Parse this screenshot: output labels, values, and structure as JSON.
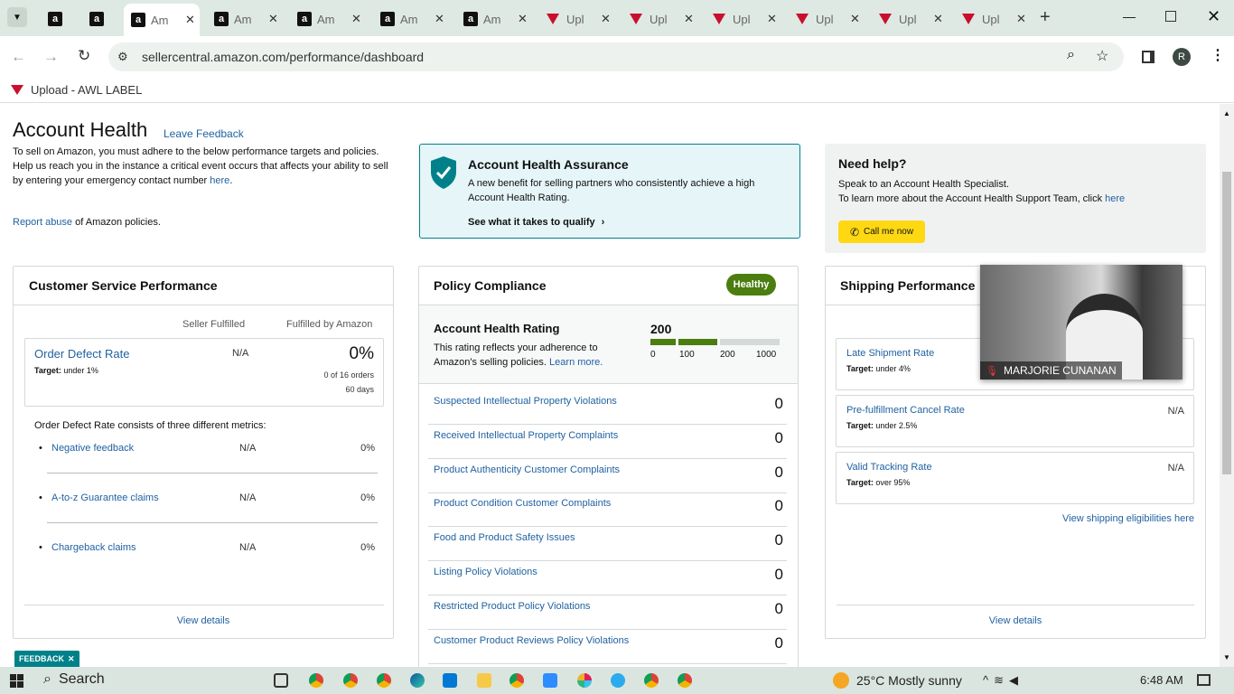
{
  "browser": {
    "tabs": [
      {
        "label": "",
        "icon": "amazon-icon"
      },
      {
        "label": "",
        "icon": "amazon-icon"
      },
      {
        "label": "Am",
        "icon": "amazon-icon",
        "active": true
      },
      {
        "label": "Am",
        "icon": "amazon-icon"
      },
      {
        "label": "Am",
        "icon": "amazon-icon"
      },
      {
        "label": "Am",
        "icon": "amazon-icon"
      },
      {
        "label": "Am",
        "icon": "amazon-icon"
      },
      {
        "label": "Upl",
        "icon": "awl-icon"
      },
      {
        "label": "Upl",
        "icon": "awl-icon"
      },
      {
        "label": "Upl",
        "icon": "awl-icon"
      },
      {
        "label": "Upl",
        "icon": "awl-icon"
      },
      {
        "label": "Upl",
        "icon": "awl-icon"
      },
      {
        "label": "Upl",
        "icon": "awl-icon"
      }
    ],
    "url": "sellercentral.amazon.com/performance/dashboard",
    "profile_initial": "R",
    "bookmark_label": "Upload - AWL LABEL"
  },
  "header": {
    "title": "Account Health",
    "feedback_link": "Leave Feedback",
    "intro_1": "To sell on Amazon, you must adhere to the below performance targets and policies.",
    "intro_2a": "Help us reach you in the instance a critical event occurs that affects your ability to sell by entering your emergency contact number ",
    "intro_2_link": "here",
    "intro_2b": ".",
    "report_link": "Report abuse",
    "report_suffix": " of Amazon policies."
  },
  "assurance": {
    "title": "Account Health Assurance",
    "text": "A new benefit for selling partners who consistently achieve a high Account Health Rating.",
    "link": "See what it takes to qualify"
  },
  "help": {
    "title": "Need help?",
    "line1": "Speak to an Account Health Specialist.",
    "line2": "To learn more about the Account Health Support Team, click ",
    "line2_link": "here",
    "button": "Call me now"
  },
  "csp": {
    "title": "Customer Service Performance",
    "col1": "Seller Fulfilled",
    "col2": "Fulfilled by Amazon",
    "odr_label": "Order Defect Rate",
    "odr_target_label": "Target:",
    "odr_target": " under 1%",
    "odr_seller": "N/A",
    "odr_fba": "0%",
    "odr_orders": "0 of 16 orders",
    "odr_days": "60 days",
    "metrics_intro": "Order Defect Rate consists of three different metrics:",
    "metrics": [
      {
        "label": "Negative feedback",
        "seller": "N/A",
        "fba": "0%"
      },
      {
        "label": "A-to-z Guarantee claims",
        "seller": "N/A",
        "fba": "0%"
      },
      {
        "label": "Chargeback claims",
        "seller": "N/A",
        "fba": "0%"
      }
    ],
    "view_details": "View details"
  },
  "policy": {
    "title": "Policy Compliance",
    "badge": "Healthy",
    "ahr_title": "Account Health Rating",
    "ahr_text": "This rating reflects your adherence to Amazon's selling policies. ",
    "ahr_link": "Learn more.",
    "ahr_value": "200",
    "ahr_max": 1000,
    "scale_labels": [
      "0",
      "100",
      "200",
      "1000"
    ],
    "items": [
      {
        "label": "Suspected Intellectual Property Violations",
        "count": "0"
      },
      {
        "label": "Received Intellectual Property Complaints",
        "count": "0"
      },
      {
        "label": "Product Authenticity Customer Complaints",
        "count": "0"
      },
      {
        "label": "Product Condition Customer Complaints",
        "count": "0"
      },
      {
        "label": "Food and Product Safety Issues",
        "count": "0"
      },
      {
        "label": "Listing Policy Violations",
        "count": "0"
      },
      {
        "label": "Restricted Product Policy Violations",
        "count": "0"
      },
      {
        "label": "Customer Product Reviews Policy Violations",
        "count": "0"
      }
    ]
  },
  "shipping": {
    "title": "Shipping Performance",
    "items": [
      {
        "label": "Late Shipment Rate",
        "target_label": "Target:",
        "target": " under 4%",
        "value": ""
      },
      {
        "label": "Pre-fulfillment Cancel Rate",
        "target_label": "Target:",
        "target": " under 2.5%",
        "value": "N/A"
      },
      {
        "label": "Valid Tracking Rate",
        "target_label": "Target:",
        "target": " over 95%",
        "value": "N/A"
      }
    ],
    "eligibility_link": "View shipping eligibilities here",
    "view_details": "View details"
  },
  "video": {
    "name": "MARJORIE CUNANAN"
  },
  "feedback_tab": "FEEDBACK",
  "taskbar": {
    "search": "Search",
    "weather": "25°C  Mostly sunny",
    "time": "6:48 AM"
  },
  "colors": {
    "link": "#2162a1",
    "healthy": "#4b7d0f",
    "assurance_bg": "#e6f5f7",
    "assurance_border": "#00818a",
    "call_button": "#ffd814"
  }
}
